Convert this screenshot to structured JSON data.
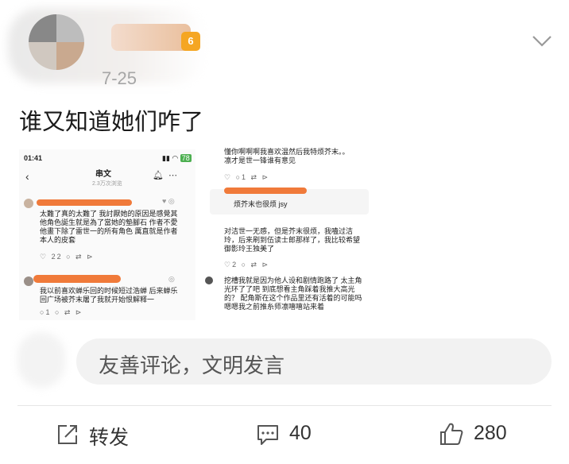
{
  "header": {
    "time": "7-25",
    "badge": "6"
  },
  "post": {
    "text": "谁又知道她们咋了"
  },
  "screenshot_left": {
    "status_time": "01:41",
    "battery": "78",
    "nav_title": "串文",
    "nav_subtitle": "2.3万次浏览",
    "c1": [
      "太難了真的太難了 我討厭她的原因是感覺其",
      "他角色誕生就是為了當她的墊腳石 作者不愛",
      "他畫下除了雷世一的所有角色 厲直就是作者",
      "本人的皮套"
    ],
    "c1_actions": "22",
    "c2": [
      "我以前喜欢蝉乐回的时候短过浩蝉 后来蝉乐",
      "回广场被芥末屠了我就开始恨解释一"
    ],
    "c2_actions": "1"
  },
  "screenshot_right": {
    "r1": [
      "懂你啊啊啊我喜欢温然后我特烦芥末。。",
      "凛才是世一锋谁有意见"
    ],
    "r1_actions": "1",
    "r2": [
      "烦芥末也很烦 jsy"
    ],
    "r3": [
      "对洁世一无感，但是芥末很烦，我嗑过洁",
      "玲，后来刷到伍读士郎那样了，我比较希望",
      "御影玲王独美了"
    ],
    "r3_actions": "2",
    "r4": [
      "挖槽我就是因为他人设和剧情跑路了 太主角",
      "光环了了吧 到底想看主角踩着我推大高光",
      "的？ 配角斯在这个作品里还有活着的可能吗",
      "嗯嗯我之前推糸师凛嘻嘻站来着"
    ]
  },
  "comment": {
    "placeholder": "友善评论，文明发言"
  },
  "footer": {
    "repost_label": "转发",
    "comment_count": "40",
    "like_count": "280"
  }
}
